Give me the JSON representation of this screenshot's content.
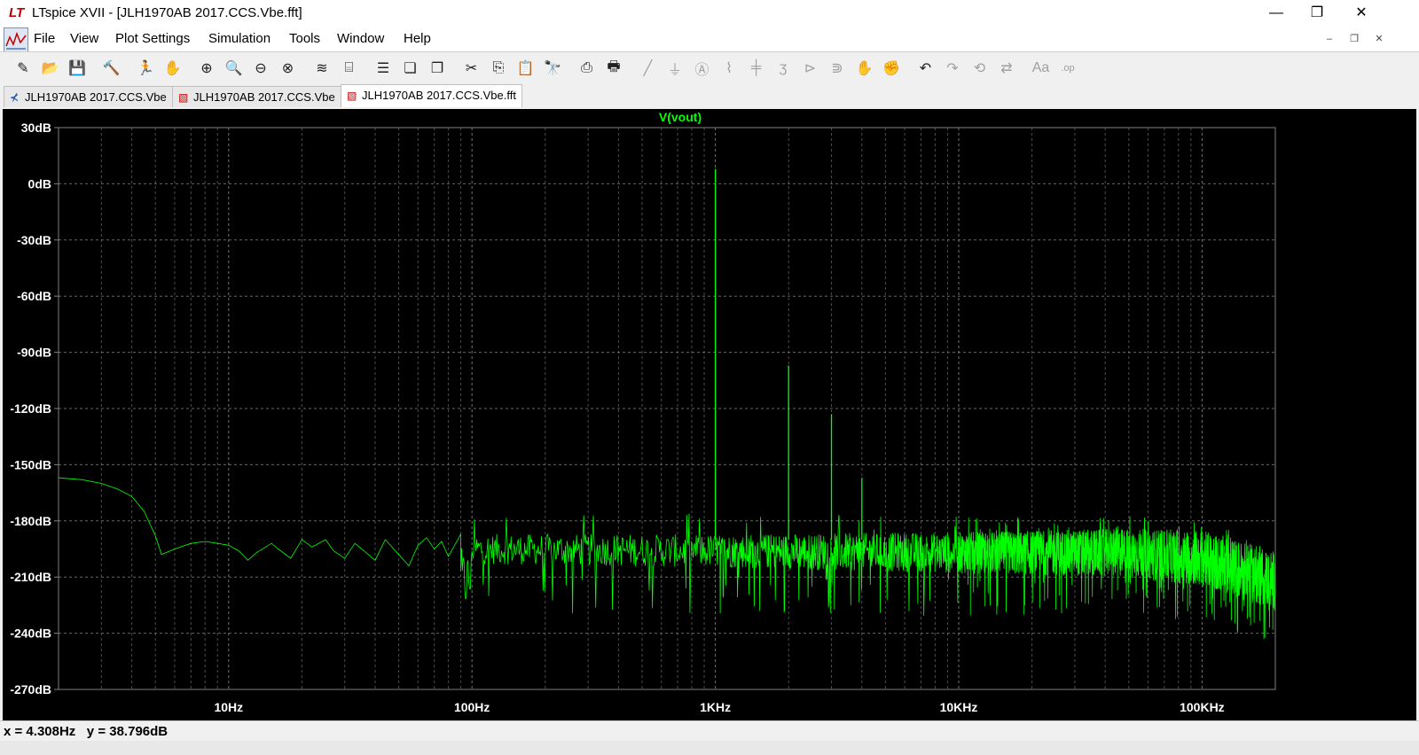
{
  "window": {
    "logo_text": "LT",
    "title": "LTspice XVII - [JLH1970AB 2017.CCS.Vbe.fft]",
    "minimize": "—",
    "maximize": "❐",
    "close": "✕"
  },
  "menu": {
    "items": [
      "File",
      "View",
      "Plot Settings",
      "Simulation",
      "Tools",
      "Window",
      "Help"
    ],
    "mdi_minimize": "–",
    "mdi_restore": "❐",
    "mdi_close": "✕"
  },
  "toolbar": {
    "icons": [
      {
        "name": "new-schematic-icon",
        "glyph": "✎",
        "enabled": true
      },
      {
        "name": "open-icon",
        "glyph": "📂",
        "enabled": true
      },
      {
        "name": "save-icon",
        "glyph": "💾",
        "enabled": true
      },
      {
        "name": "control-panel-icon",
        "glyph": "🔨",
        "enabled": true
      },
      {
        "name": "run-icon",
        "glyph": "🏃",
        "enabled": false
      },
      {
        "name": "halt-icon",
        "glyph": "✋",
        "enabled": false
      },
      {
        "name": "zoom-area-icon",
        "glyph": "⊕",
        "enabled": true
      },
      {
        "name": "pan-icon",
        "glyph": "🔍",
        "enabled": true
      },
      {
        "name": "zoom-out-icon",
        "glyph": "⊖",
        "enabled": true
      },
      {
        "name": "zoom-fit-icon",
        "glyph": "⊗",
        "enabled": true
      },
      {
        "name": "autorange-icon",
        "glyph": "≋",
        "enabled": true
      },
      {
        "name": "measure-icon",
        "glyph": "⌸",
        "enabled": true
      },
      {
        "name": "tile-horizontal-icon",
        "glyph": "☰",
        "enabled": true
      },
      {
        "name": "cascade-icon",
        "glyph": "❏",
        "enabled": true
      },
      {
        "name": "tile-vertical-icon",
        "glyph": "❐",
        "enabled": true
      },
      {
        "name": "cut-icon",
        "glyph": "✂",
        "enabled": true
      },
      {
        "name": "copy-icon",
        "glyph": "⎘",
        "enabled": true
      },
      {
        "name": "paste-icon",
        "glyph": "📋",
        "enabled": false
      },
      {
        "name": "find-icon",
        "glyph": "🔭",
        "enabled": true
      },
      {
        "name": "print-icon",
        "glyph": "⎙",
        "enabled": true
      },
      {
        "name": "print-setup-icon",
        "glyph": "🖶",
        "enabled": true
      },
      {
        "name": "wire-icon",
        "glyph": "╱",
        "enabled": false
      },
      {
        "name": "ground-icon",
        "glyph": "⏚",
        "enabled": false
      },
      {
        "name": "label-net-icon",
        "glyph": "Ⓐ",
        "enabled": false
      },
      {
        "name": "resistor-icon",
        "glyph": "⌇",
        "enabled": false
      },
      {
        "name": "capacitor-icon",
        "glyph": "╪",
        "enabled": false
      },
      {
        "name": "inductor-icon",
        "glyph": "ʒ",
        "enabled": false
      },
      {
        "name": "diode-icon",
        "glyph": "⊳",
        "enabled": false
      },
      {
        "name": "component-icon",
        "glyph": "⋑",
        "enabled": false
      },
      {
        "name": "move-icon",
        "glyph": "✋",
        "enabled": false
      },
      {
        "name": "drag-icon",
        "glyph": "✊",
        "enabled": false
      },
      {
        "name": "undo-icon",
        "glyph": "↶",
        "enabled": true
      },
      {
        "name": "redo-icon",
        "glyph": "↷",
        "enabled": false
      },
      {
        "name": "rotate-icon",
        "glyph": "⟲",
        "enabled": false
      },
      {
        "name": "mirror-icon",
        "glyph": "⇄",
        "enabled": false
      },
      {
        "name": "text-icon",
        "glyph": "Aa",
        "enabled": false
      },
      {
        "name": "spice-directive-icon",
        "glyph": ".op",
        "enabled": false
      }
    ]
  },
  "tabs": [
    {
      "label": "JLH1970AB 2017.CCS.Vbe",
      "icon": "schematic-icon",
      "glyph": "⊀",
      "active": false
    },
    {
      "label": "JLH1970AB 2017.CCS.Vbe",
      "icon": "waveform-icon",
      "glyph": "▧",
      "active": false
    },
    {
      "label": "JLH1970AB 2017.CCS.Vbe.fft",
      "icon": "waveform-icon",
      "glyph": "▧",
      "active": true
    }
  ],
  "status": {
    "cursor_readout": "x = 4.308Hz   y = 38.796dB"
  },
  "chart_data": {
    "type": "line",
    "title": "V(vout)",
    "x_scale": "log",
    "xlim": [
      2,
      200000
    ],
    "ylim": [
      -270,
      30
    ],
    "x_ticks": [
      {
        "value": 10,
        "label": "10Hz"
      },
      {
        "value": 100,
        "label": "100Hz"
      },
      {
        "value": 1000,
        "label": "1KHz"
      },
      {
        "value": 10000,
        "label": "10KHz"
      },
      {
        "value": 100000,
        "label": "100KHz"
      }
    ],
    "y_ticks": [
      {
        "value": 30,
        "label": "30dB"
      },
      {
        "value": 0,
        "label": "0dB"
      },
      {
        "value": -30,
        "label": "-30dB"
      },
      {
        "value": -60,
        "label": "-60dB"
      },
      {
        "value": -90,
        "label": "-90dB"
      },
      {
        "value": -120,
        "label": "-120dB"
      },
      {
        "value": -150,
        "label": "-150dB"
      },
      {
        "value": -180,
        "label": "-180dB"
      },
      {
        "value": -210,
        "label": "-210dB"
      },
      {
        "value": -240,
        "label": "-240dB"
      },
      {
        "value": -270,
        "label": "-270dB"
      }
    ],
    "grid": true,
    "trace_color": "#00ff00",
    "grid_color": "#808080",
    "background": "#000000",
    "series": [
      {
        "name": "V(vout)",
        "low_freq_curve": [
          {
            "x": 2,
            "y": -157
          },
          {
            "x": 2.5,
            "y": -158
          },
          {
            "x": 3,
            "y": -160
          },
          {
            "x": 3.5,
            "y": -163
          },
          {
            "x": 4,
            "y": -167
          },
          {
            "x": 4.5,
            "y": -175
          },
          {
            "x": 5,
            "y": -188
          },
          {
            "x": 5.3,
            "y": -198
          },
          {
            "x": 6,
            "y": -195
          },
          {
            "x": 7,
            "y": -192
          },
          {
            "x": 8,
            "y": -191
          },
          {
            "x": 9,
            "y": -192
          },
          {
            "x": 10,
            "y": -193
          },
          {
            "x": 11,
            "y": -196
          },
          {
            "x": 12,
            "y": -201
          },
          {
            "x": 13,
            "y": -197
          },
          {
            "x": 15,
            "y": -192
          },
          {
            "x": 16,
            "y": -195
          },
          {
            "x": 18,
            "y": -200
          },
          {
            "x": 20,
            "y": -190
          },
          {
            "x": 22,
            "y": -194
          },
          {
            "x": 25,
            "y": -190
          },
          {
            "x": 27,
            "y": -196
          },
          {
            "x": 30,
            "y": -200
          },
          {
            "x": 33,
            "y": -192
          },
          {
            "x": 36,
            "y": -196
          },
          {
            "x": 40,
            "y": -201
          },
          {
            "x": 44,
            "y": -190
          },
          {
            "x": 50,
            "y": -198
          },
          {
            "x": 55,
            "y": -204
          },
          {
            "x": 60,
            "y": -193
          },
          {
            "x": 65,
            "y": -189
          },
          {
            "x": 70,
            "y": -195
          },
          {
            "x": 75,
            "y": -191
          },
          {
            "x": 80,
            "y": -199
          },
          {
            "x": 90,
            "y": -187
          }
        ],
        "harmonic_peaks": [
          {
            "x": 1000,
            "y": 8
          },
          {
            "x": 2000,
            "y": -97
          },
          {
            "x": 3000,
            "y": -123
          },
          {
            "x": 4000,
            "y": -157
          }
        ],
        "noise_floor": [
          {
            "x": 100,
            "y": -195,
            "spread": 16
          },
          {
            "x": 1000,
            "y": -196,
            "spread": 18
          },
          {
            "x": 10000,
            "y": -197,
            "spread": 22
          },
          {
            "x": 50000,
            "y": -197,
            "spread": 26
          },
          {
            "x": 100000,
            "y": -200,
            "spread": 30
          },
          {
            "x": 200000,
            "y": -212,
            "spread": 32
          }
        ]
      }
    ]
  }
}
